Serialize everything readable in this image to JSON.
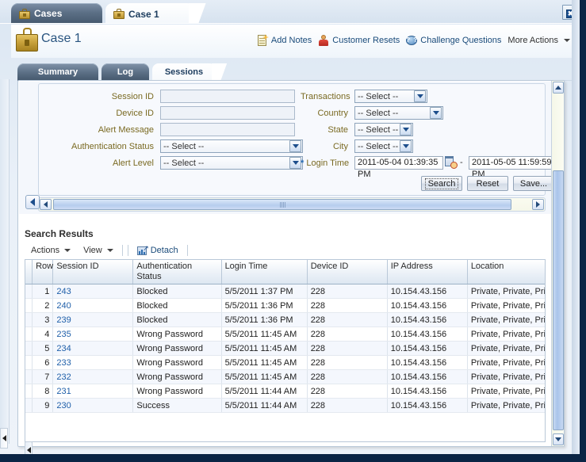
{
  "window": {
    "top_tabs": [
      {
        "label": "Cases",
        "icon": "briefcase-icon",
        "active": false
      },
      {
        "label": "Case 1",
        "icon": "briefcase-icon",
        "active": true
      }
    ],
    "window_icon": "restore-window-icon"
  },
  "header": {
    "title": "Case 1",
    "icon": "briefcase-icon",
    "actions": [
      {
        "label": "Add Notes",
        "icon": "add-note-icon"
      },
      {
        "label": "Customer Resets",
        "icon": "person-icon"
      },
      {
        "label": "Challenge Questions",
        "icon": "question-face-icon"
      },
      {
        "label": "More Actions",
        "icon": "chevron-down-icon"
      }
    ]
  },
  "sub_tabs": [
    {
      "label": "Summary",
      "active": false
    },
    {
      "label": "Log",
      "active": false
    },
    {
      "label": "Sessions",
      "active": true
    }
  ],
  "search_form": {
    "left_column": [
      {
        "label": "Session ID",
        "type": "text",
        "value": ""
      },
      {
        "label": "Device ID",
        "type": "text",
        "value": ""
      },
      {
        "label": "Alert Message",
        "type": "text",
        "value": ""
      },
      {
        "label": "Authentication Status",
        "type": "select",
        "value": "-- Select --"
      },
      {
        "label": "Alert Level",
        "type": "select",
        "value": "-- Select --"
      }
    ],
    "right_column": [
      {
        "label": "Transactions",
        "type": "select",
        "value": "-- Select --"
      },
      {
        "label": "Country",
        "type": "select",
        "value": "-- Select --"
      },
      {
        "label": "State",
        "type": "select",
        "value": "-- Select --"
      },
      {
        "label": "City",
        "type": "select",
        "value": "-- Select --"
      }
    ],
    "login_time": {
      "label": "Login Time",
      "required_marker": "*",
      "from_value": "2011-05-04 01:39:35 PM",
      "to_value": "2011-05-05 11:59:59 PM",
      "separator": "-",
      "calendar_icon": "calendar-clock-icon"
    },
    "buttons": {
      "search": "Search",
      "reset": "Reset",
      "save": "Save..."
    }
  },
  "results": {
    "title": "Search Results",
    "toolbar": {
      "actions": "Actions",
      "view": "View",
      "detach": "Detach"
    },
    "columns": [
      "Row",
      "Session ID",
      "Authentication Status",
      "Login Time",
      "Device ID",
      "IP Address",
      "Location"
    ],
    "rows": [
      {
        "row": "1",
        "session_id": "243",
        "auth_status": "Blocked",
        "login_time": "5/5/2011 1:37 PM",
        "device_id": "228",
        "ip": "10.154.43.156",
        "location": "Private, Private, Priva"
      },
      {
        "row": "2",
        "session_id": "240",
        "auth_status": "Blocked",
        "login_time": "5/5/2011 1:36 PM",
        "device_id": "228",
        "ip": "10.154.43.156",
        "location": "Private, Private, Priva"
      },
      {
        "row": "3",
        "session_id": "239",
        "auth_status": "Blocked",
        "login_time": "5/5/2011 1:36 PM",
        "device_id": "228",
        "ip": "10.154.43.156",
        "location": "Private, Private, Priva"
      },
      {
        "row": "4",
        "session_id": "235",
        "auth_status": "Wrong Password",
        "login_time": "5/5/2011 11:45 AM",
        "device_id": "228",
        "ip": "10.154.43.156",
        "location": "Private, Private, Priva"
      },
      {
        "row": "5",
        "session_id": "234",
        "auth_status": "Wrong Password",
        "login_time": "5/5/2011 11:45 AM",
        "device_id": "228",
        "ip": "10.154.43.156",
        "location": "Private, Private, Priva"
      },
      {
        "row": "6",
        "session_id": "233",
        "auth_status": "Wrong Password",
        "login_time": "5/5/2011 11:45 AM",
        "device_id": "228",
        "ip": "10.154.43.156",
        "location": "Private, Private, Priva"
      },
      {
        "row": "7",
        "session_id": "232",
        "auth_status": "Wrong Password",
        "login_time": "5/5/2011 11:45 AM",
        "device_id": "228",
        "ip": "10.154.43.156",
        "location": "Private, Private, Priva"
      },
      {
        "row": "8",
        "session_id": "231",
        "auth_status": "Wrong Password",
        "login_time": "5/5/2011 11:44 AM",
        "device_id": "228",
        "ip": "10.154.43.156",
        "location": "Private, Private, Priva"
      },
      {
        "row": "9",
        "session_id": "230",
        "auth_status": "Success",
        "login_time": "5/5/2011 11:44 AM",
        "device_id": "228",
        "ip": "10.154.43.156",
        "location": "Private, Private, Priva"
      }
    ]
  },
  "colors": {
    "label": "#7a6a22",
    "link": "#1f5fa9",
    "title": "#2a5580",
    "required": "#2c6fb5",
    "panel_bg": "#f4f7fc",
    "row_even": "#f4f7fd"
  }
}
